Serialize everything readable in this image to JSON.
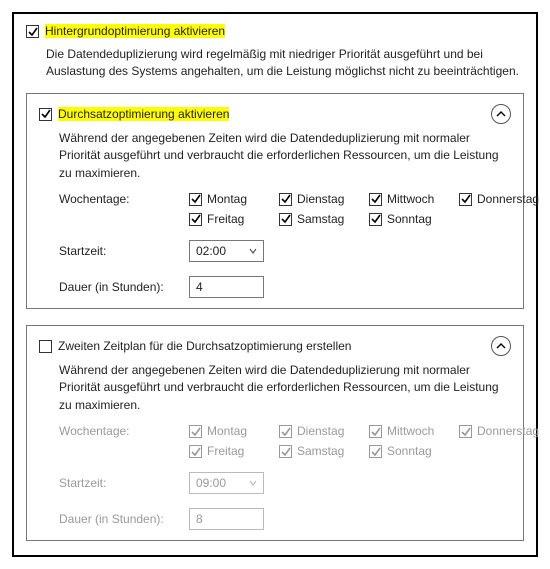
{
  "background": {
    "label": "Hintergrundoptimierung aktivieren",
    "checked": true,
    "description": "Die Datendeduplizierung wird regelmäßig mit niedriger Priorität ausgeführt und bei Auslastung des Systems angehalten, um die Leistung möglichst nicht zu beeinträchtigen."
  },
  "schedule1": {
    "label": "Durchsatzoptimierung aktivieren",
    "checked": true,
    "enabled": true,
    "description": "Während der angegebenen Zeiten wird die Datendeduplizierung mit normaler Priorität ausgeführt und verbraucht die erforderlichen Ressourcen, um die Leistung zu maximieren.",
    "weekdays_label": "Wochentage:",
    "days": {
      "mon": {
        "label": "Montag",
        "checked": true
      },
      "tue": {
        "label": "Dienstag",
        "checked": true
      },
      "wed": {
        "label": "Mittwoch",
        "checked": true
      },
      "thu": {
        "label": "Donnerstag",
        "checked": true
      },
      "fri": {
        "label": "Freitag",
        "checked": true
      },
      "sat": {
        "label": "Samstag",
        "checked": true
      },
      "sun": {
        "label": "Sonntag",
        "checked": true
      }
    },
    "start_label": "Startzeit:",
    "start_value": "02:00",
    "duration_label": "Dauer (in Stunden):",
    "duration_value": "4"
  },
  "schedule2": {
    "label": "Zweiten Zeitplan für die Durchsatzoptimierung erstellen",
    "checked": false,
    "enabled": false,
    "description": "Während der angegebenen Zeiten wird die Datendeduplizierung mit normaler Priorität ausgeführt und verbraucht die erforderlichen Ressourcen, um die Leistung zu maximieren.",
    "weekdays_label": "Wochentage:",
    "days": {
      "mon": {
        "label": "Montag",
        "checked": true
      },
      "tue": {
        "label": "Dienstag",
        "checked": true
      },
      "wed": {
        "label": "Mittwoch",
        "checked": true
      },
      "thu": {
        "label": "Donnerstag",
        "checked": true
      },
      "fri": {
        "label": "Freitag",
        "checked": true
      },
      "sat": {
        "label": "Samstag",
        "checked": true
      },
      "sun": {
        "label": "Sonntag",
        "checked": true
      }
    },
    "start_label": "Startzeit:",
    "start_value": "09:00",
    "duration_label": "Dauer (in Stunden):",
    "duration_value": "8"
  }
}
